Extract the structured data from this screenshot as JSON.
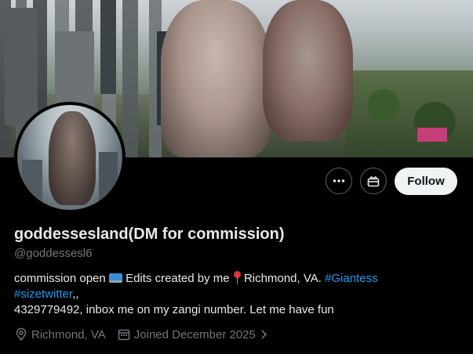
{
  "profile": {
    "display_name": "goddessesland(DM for commission)",
    "handle": "@goddessesl6",
    "bio": {
      "line1_text": "commission open",
      "line1_text2": "Edits created by me",
      "line1_text3": "Richmond, VA.",
      "hashtag1": "#Giantess",
      "hashtag2": "#sizetwitter",
      "line2_suffix": ",,",
      "line3": "4329779492, inbox  me on my zangi number. Let me have fun"
    },
    "location": "Richmond, VA",
    "joined": "Joined December 2025"
  },
  "actions": {
    "follow_label": "Follow"
  },
  "icons": {
    "more": "more-horizontal-icon",
    "subscribe": "subscribe-icon",
    "location": "location-pin-icon",
    "calendar": "calendar-icon",
    "chevron": "chevron-right-icon"
  },
  "colors": {
    "background": "#000000",
    "text": "#e7e9ea",
    "secondary_text": "#71767b",
    "link": "#1d9bf0",
    "follow_bg": "#eff3f4"
  }
}
